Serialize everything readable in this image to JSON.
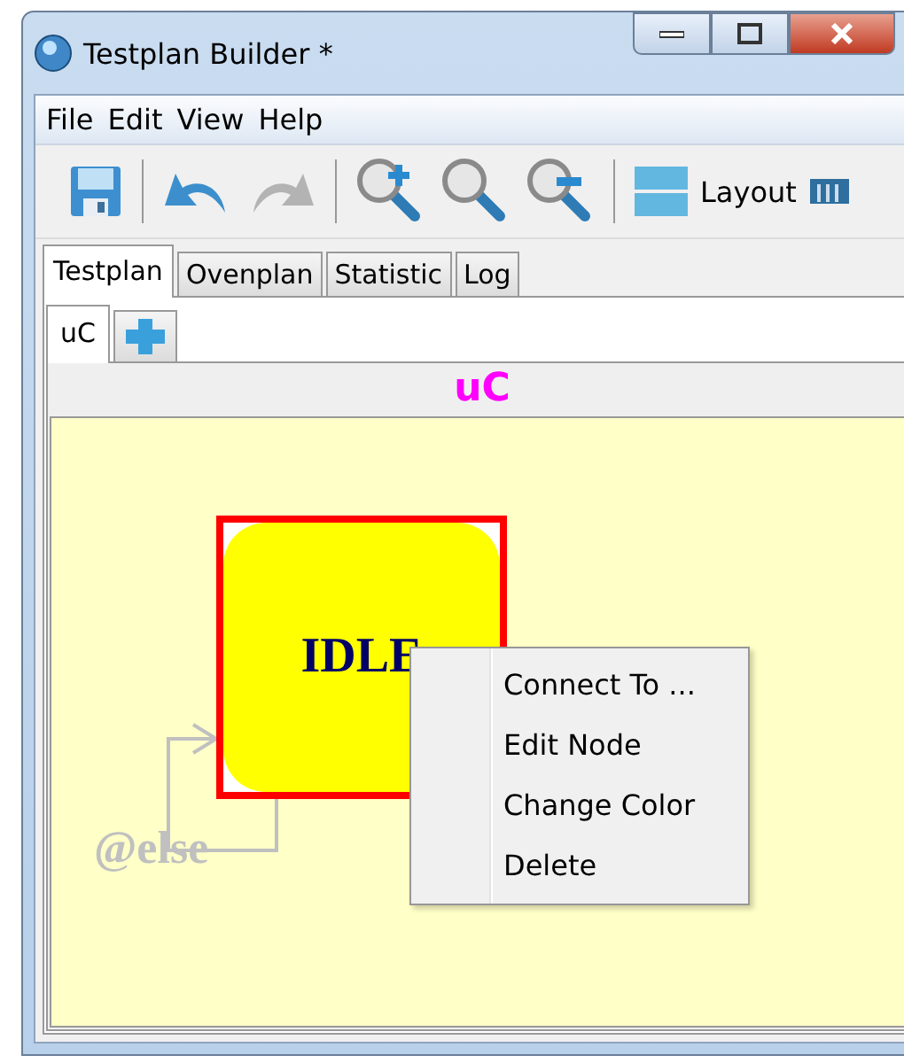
{
  "window": {
    "title": "Testplan Builder  *"
  },
  "menu_bar": [
    "File",
    "Edit",
    "View",
    "Help"
  ],
  "toolbar": [
    {
      "kind": "save"
    },
    {
      "kind": "sep"
    },
    {
      "kind": "undo"
    },
    {
      "kind": "redo",
      "disabled": true
    },
    {
      "kind": "sep"
    },
    {
      "kind": "zoom-in"
    },
    {
      "kind": "zoom"
    },
    {
      "kind": "zoom-out"
    },
    {
      "kind": "sep"
    },
    {
      "kind": "layout",
      "label": "Layout"
    },
    {
      "kind": "more"
    }
  ],
  "tabs": [
    {
      "label": "Testplan",
      "selected": true
    },
    {
      "label": "Ovenplan",
      "selected": false
    },
    {
      "label": "Statistic",
      "selected": false
    },
    {
      "label": "Log",
      "selected": false
    }
  ],
  "subtabs": [
    {
      "kind": "text",
      "label": "uC",
      "selected": true
    },
    {
      "kind": "add",
      "selected": false
    }
  ],
  "panel": {
    "title": "uC"
  },
  "node": {
    "label": "IDLE",
    "selected": true
  },
  "edge": {
    "label": "@else"
  },
  "context_menu": [
    "Connect To ...",
    "Edit Node",
    "Change Color",
    "Delete"
  ]
}
